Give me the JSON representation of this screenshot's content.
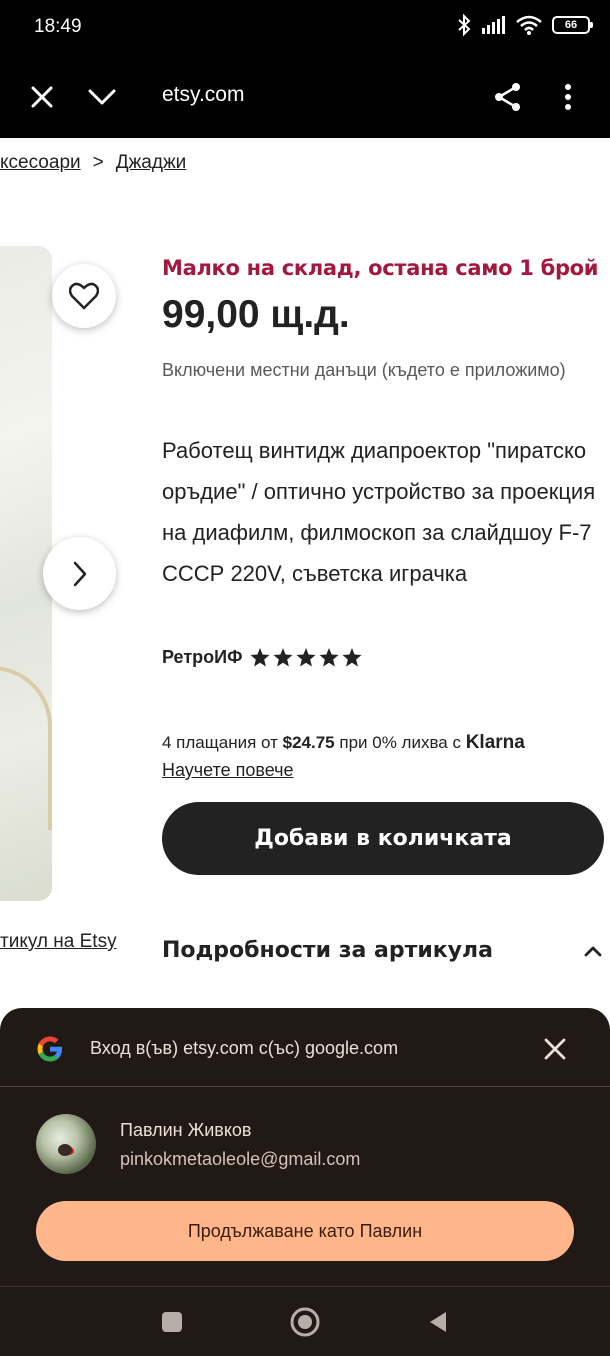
{
  "status": {
    "time": "18:49",
    "battery": "66"
  },
  "browser": {
    "url": "etsy.com"
  },
  "breadcrumb": {
    "items": [
      "ксесоари",
      "Джаджи"
    ],
    "separator": ">"
  },
  "product": {
    "stock_notice": "Малко на склад, остана само 1 брой",
    "price": "99,00 щ.д.",
    "tax_note": "Включени местни данъци (където е приложимо)",
    "title": "Работещ винтидж диапроектор \"пиратско оръдие\" / оптично устройство за проекция на диафилм, филмоскоп за слайдшоу F-7 СССР 220V, съветска играчка",
    "shop_name": "РетроИФ",
    "rating_stars": 5,
    "klarna": {
      "prefix": "4 плащания от",
      "amount": "$24.75",
      "suffix": "при 0% лихва с",
      "brand": "Klarna",
      "learn_more": "Научете повече"
    },
    "add_to_cart": "Добави в количката",
    "details_label": "Подробности за артикула",
    "report_link": "тикул на Etsy"
  },
  "google_sheet": {
    "title": "Вход в(ъв) etsy.com с(ъс) google.com",
    "account_name": "Павлин Живков",
    "account_email": "pinkokmetaoleole@gmail.com",
    "continue_label": "Продължаване като Павлин"
  },
  "colors": {
    "stock_red": "#a3183e",
    "cart_button": "#222222",
    "sheet_bg": "#201915",
    "continue_button": "#ffb68a"
  }
}
